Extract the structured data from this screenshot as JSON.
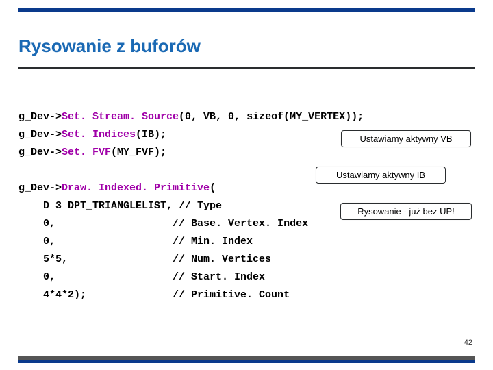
{
  "title": "Rysowanie z buforów",
  "page_number": "42",
  "callouts": {
    "vb": "Ustawiamy aktywny VB",
    "ib": "Ustawiamy aktywny IB",
    "draw": "Rysowanie - już bez UP!"
  },
  "code": {
    "l1": {
      "obj": "g_Dev->",
      "kw": "Set. Stream. Source",
      "rest": "(0, VB, 0, sizeof(MY_VERTEX));"
    },
    "l2": {
      "obj": "g_Dev->",
      "kw": "Set. Indices",
      "rest": "(IB);"
    },
    "l3": {
      "obj": "g_Dev->",
      "kw": "Set. FVF",
      "rest": "(MY_FVF);"
    },
    "blank": "",
    "l5": {
      "obj": "g_Dev->",
      "kw": "Draw. Indexed. Primitive",
      "rest": "("
    },
    "l6": "    D 3 DPT_TRIANGLELIST, // Type",
    "l7": "    0,                   // Base. Vertex. Index",
    "l8": "    0,                   // Min. Index",
    "l9": "    5*5,                 // Num. Vertices",
    "l10": "    0,                   // Start. Index",
    "l11": "    4*4*2);              // Primitive. Count"
  }
}
